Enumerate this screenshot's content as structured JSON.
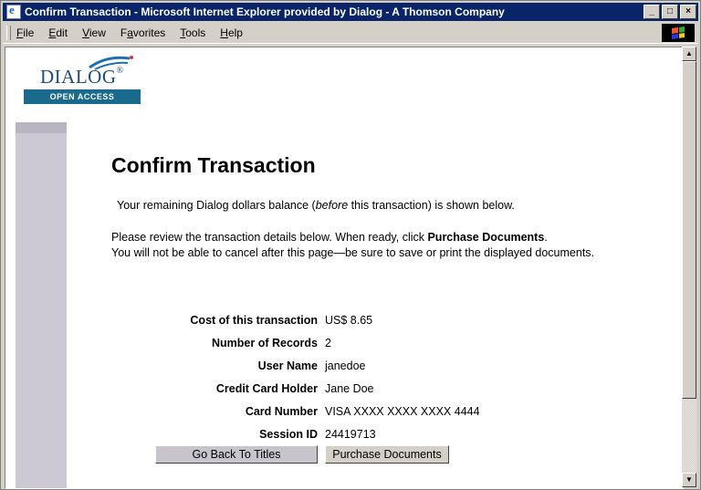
{
  "window": {
    "title": "Confirm Transaction - Microsoft Internet Explorer provided by Dialog - A Thomson Company",
    "controls": [
      "minimize-icon",
      "maximize-icon",
      "close-icon"
    ]
  },
  "menubar": {
    "items": [
      {
        "label": "File",
        "key": "F",
        "rest": "ile"
      },
      {
        "label": "Edit",
        "key": "E",
        "rest": "dit"
      },
      {
        "label": "View",
        "key": "V",
        "rest": "iew"
      },
      {
        "label": "Favorites",
        "key": "a",
        "pre": "F",
        "rest": "vorites"
      },
      {
        "label": "Tools",
        "key": "T",
        "rest": "ools"
      },
      {
        "label": "Help",
        "key": "H",
        "rest": "elp"
      }
    ]
  },
  "logo": {
    "word": "DIALOG",
    "reg": "®",
    "band": "OPEN ACCESS",
    "colors": {
      "word": "#1f4e7a",
      "band": "#1a6a8e"
    }
  },
  "page": {
    "heading": "Confirm Transaction",
    "balance_pre": "Your remaining Dialog dollars balance (",
    "balance_em": "before",
    "balance_post": " this transaction) is shown below.",
    "review_pre": "Please review the transaction details below. When ready, click ",
    "review_bold": "Purchase Documents",
    "review_post": ".",
    "warning": "You will not be able to cancel after this page—be sure to save or print the displayed documents."
  },
  "details": [
    {
      "label": "Cost of this transaction",
      "value": "US$ 8.65"
    },
    {
      "label": "Number of Records",
      "value": "2"
    },
    {
      "label": "User Name",
      "value": "janedoe"
    },
    {
      "label": "Credit Card Holder",
      "value": "Jane Doe"
    },
    {
      "label": "Card Number",
      "value": "VISA XXXX XXXX XXXX 4444"
    },
    {
      "label": "Session ID",
      "value": "24419713"
    }
  ],
  "buttons": {
    "back": "Go Back To Titles",
    "purchase": "Purchase Documents"
  }
}
